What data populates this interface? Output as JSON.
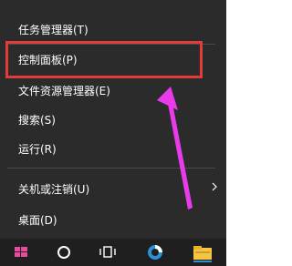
{
  "context_menu": {
    "items": [
      {
        "label": "任务管理器(T)"
      },
      {
        "label": "控制面板(P)"
      },
      {
        "label": "文件资源管理器(E)"
      },
      {
        "label": "搜索(S)"
      },
      {
        "label": "运行(R)"
      },
      {
        "label": "关机或注销(U)"
      },
      {
        "label": "桌面(D)"
      }
    ],
    "highlight_color": "#e23b3b"
  },
  "annotation": {
    "arrow_color": "#e83bea"
  },
  "taskbar": {
    "icons": [
      "windows-start-icon",
      "cortana-circle-icon",
      "task-view-icon",
      "browser-icon",
      "file-explorer-icon"
    ]
  }
}
